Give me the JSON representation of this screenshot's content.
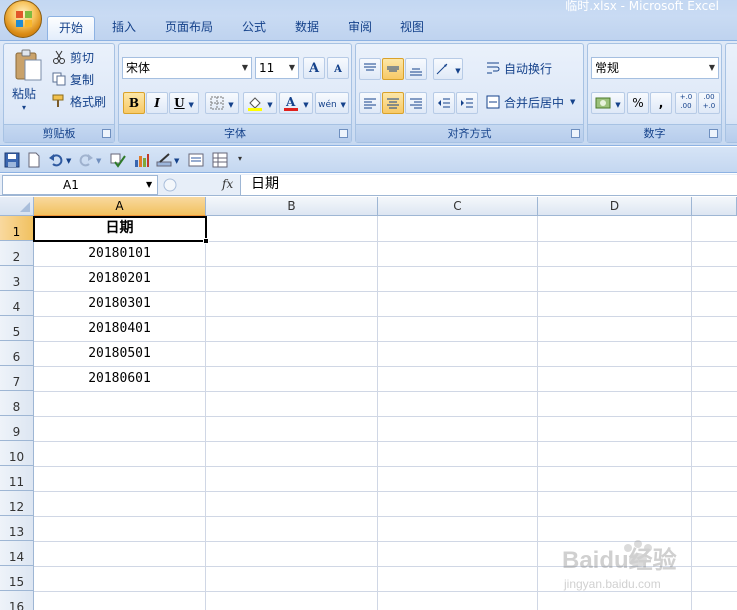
{
  "window": {
    "title": "临时.xlsx - Microsoft Excel"
  },
  "tabs": [
    {
      "label": "开始",
      "active": true
    },
    {
      "label": "插入",
      "active": false
    },
    {
      "label": "页面布局",
      "active": false
    },
    {
      "label": "公式",
      "active": false
    },
    {
      "label": "数据",
      "active": false
    },
    {
      "label": "审阅",
      "active": false
    },
    {
      "label": "视图",
      "active": false
    }
  ],
  "ribbon": {
    "clipboard": {
      "group_label": "剪贴板",
      "paste_label": "粘贴",
      "cut_label": "剪切",
      "copy_label": "复制",
      "format_painter_label": "格式刷"
    },
    "font": {
      "group_label": "字体",
      "font_name": "宋体",
      "font_size": "11",
      "bold": "B",
      "italic": "I",
      "underline": "U",
      "grow": "A",
      "shrink": "A",
      "phonetic": "wén"
    },
    "alignment": {
      "group_label": "对齐方式",
      "wrap_text_label": "自动换行",
      "merge_label": "合并后居中"
    },
    "number": {
      "group_label": "数字",
      "format_value": "常规",
      "percent": "%",
      "comma": ",",
      "inc_decimal": "+.0 .00",
      "dec_decimal": ".00 +.0"
    }
  },
  "formula_bar": {
    "name_box": "A1",
    "fx_label": "fx",
    "content": "日期"
  },
  "sheet": {
    "columns": [
      "A",
      "B",
      "C",
      "D"
    ],
    "rows": [
      "1",
      "2",
      "3",
      "4",
      "5",
      "6",
      "7",
      "8",
      "9",
      "10",
      "11",
      "12",
      "13",
      "14",
      "15",
      "16"
    ],
    "column_a": [
      "日期",
      "20180101",
      "20180201",
      "20180301",
      "20180401",
      "20180501",
      "20180601"
    ],
    "active_cell": "A1"
  },
  "watermark": {
    "line1": "Baidu经验",
    "line2": "jingyan.baidu.com"
  },
  "colors": {
    "accent": "#15428b",
    "selected_header": "#f1c15f",
    "grid_line": "#d0d7e5"
  }
}
